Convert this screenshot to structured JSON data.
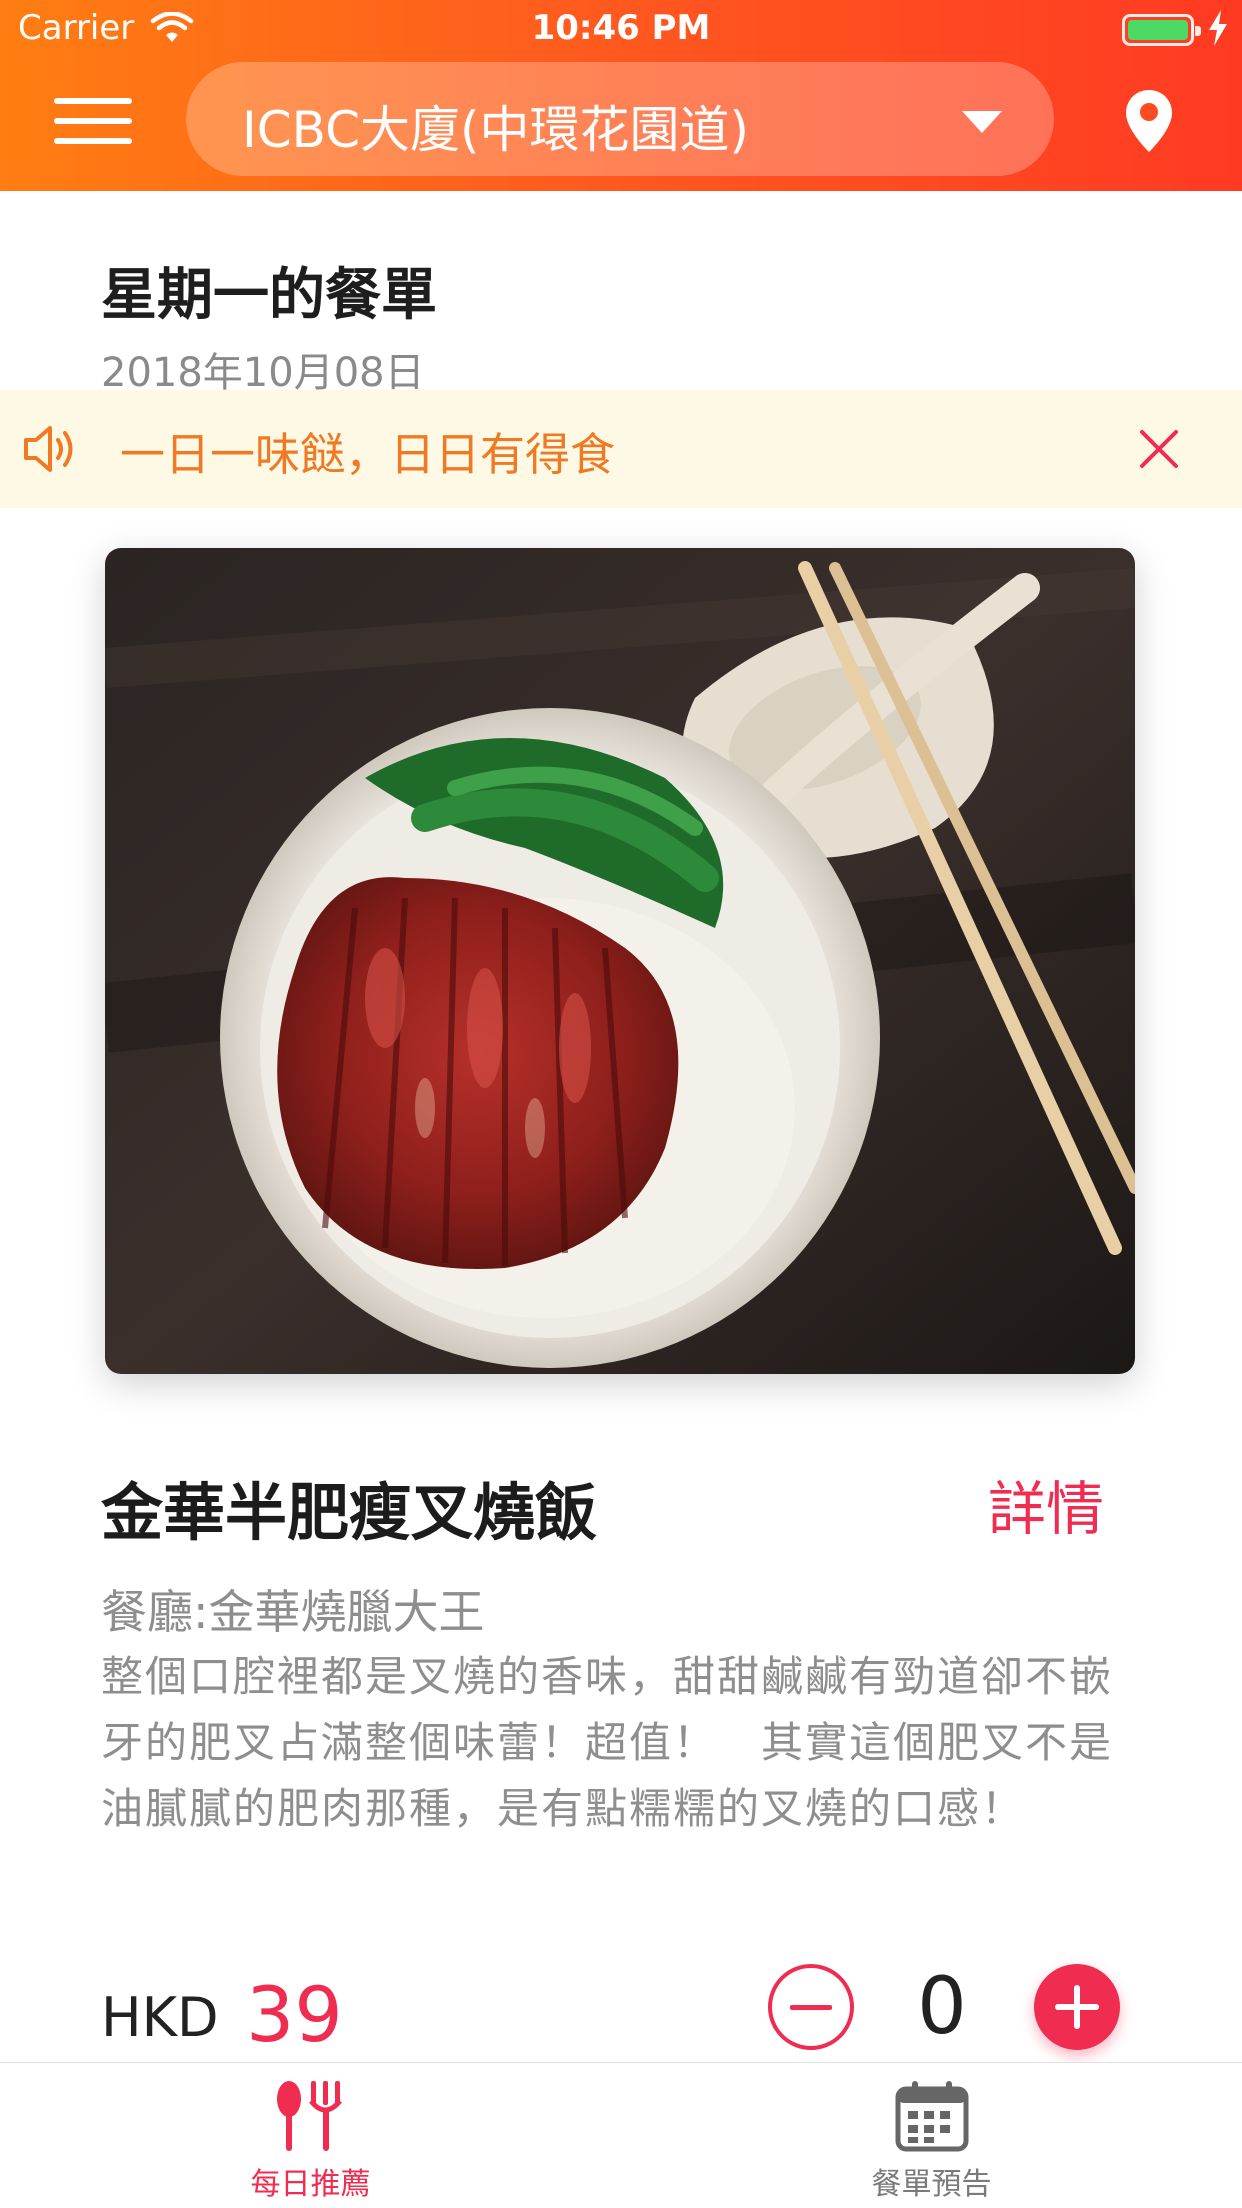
{
  "status_bar": {
    "carrier": "Carrier",
    "time": "10:46 PM"
  },
  "header": {
    "location": "ICBC大廈(中環花園道)",
    "menu_icon": "hamburger-menu-icon",
    "location_icon": "map-pin-icon",
    "dropdown_icon": "caret-down-icon"
  },
  "menu": {
    "title": "星期一的餐單",
    "date": "2018年10月08日"
  },
  "notice": {
    "text": "一日一味餸，日日有得食",
    "icon": "speaker-icon",
    "close_icon": "close-icon"
  },
  "dish": {
    "name": "金華半肥瘦叉燒飯",
    "details_label": "詳情",
    "restaurant": "餐廳:金華燒臘大王",
    "description": "整個口腔裡都是叉燒的香味，甜甜鹹鹹有勁道卻不嵌牙的肥叉占滿整個味蕾！超值！　其實這個肥叉不是油膩膩的肥肉那種，是有點糯糯的叉燒的口感！",
    "image_icon": "food-photo"
  },
  "order": {
    "currency": "HKD",
    "price": "39",
    "quantity": "0"
  },
  "tabs": [
    {
      "label": "每日推薦",
      "icon": "fork-knife-icon",
      "active": true
    },
    {
      "label": "餐單預告",
      "icon": "calendar-icon",
      "active": false
    }
  ],
  "colors": {
    "accent": "#f02c50",
    "header_start": "#ff7d12",
    "header_end": "#ff3a22",
    "notice_bg": "#fdf9e5",
    "notice_text": "#f07a24"
  }
}
